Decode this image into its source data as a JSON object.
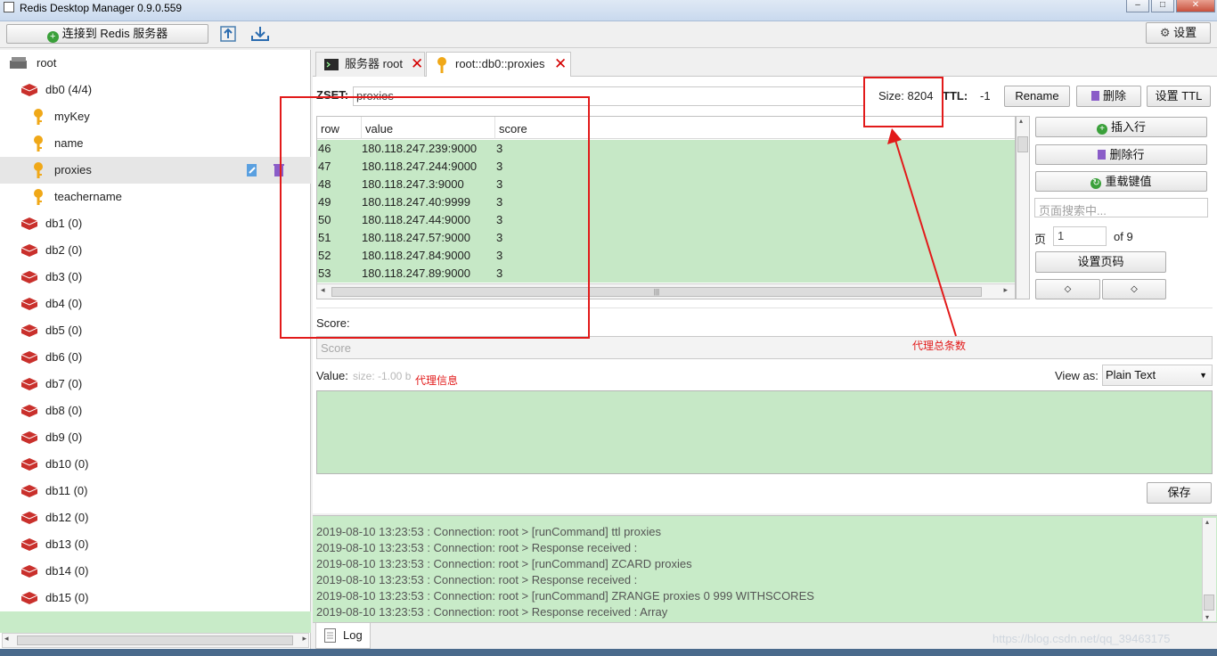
{
  "window": {
    "title": "Redis Desktop Manager 0.9.0.559"
  },
  "toolbar": {
    "connect_label": "连接到 Redis 服务器",
    "settings_label": "设置"
  },
  "sidebar": {
    "root_label": "root",
    "db0_label": "db0  (4/4)",
    "keys": [
      "myKey",
      "name",
      "proxies",
      "teachername"
    ],
    "dbs": [
      "db1 (0)",
      "db2 (0)",
      "db3 (0)",
      "db4 (0)",
      "db5 (0)",
      "db6 (0)",
      "db7 (0)",
      "db8 (0)",
      "db9 (0)",
      "db10 (0)",
      "db11 (0)",
      "db12 (0)",
      "db13 (0)",
      "db14 (0)",
      "db15 (0)"
    ]
  },
  "tabs": [
    {
      "label": "服务器 root"
    },
    {
      "label": "root::db0::proxies"
    }
  ],
  "key_header": {
    "type_label": "ZSET:",
    "key_name": "proxies",
    "size_text": "Size: 8204",
    "ttl_label": "TTL:",
    "ttl_value": "-1",
    "rename_label": "Rename",
    "delete_label": "删除",
    "set_ttl_label": "设置 TTL"
  },
  "grid": {
    "columns": [
      "row",
      "value",
      "score"
    ],
    "rows": [
      [
        "46",
        "180.118.247.239:9000",
        "3"
      ],
      [
        "47",
        "180.118.247.244:9000",
        "3"
      ],
      [
        "48",
        "180.118.247.3:9000",
        "3"
      ],
      [
        "49",
        "180.118.247.40:9999",
        "3"
      ],
      [
        "50",
        "180.118.247.44:9000",
        "3"
      ],
      [
        "51",
        "180.118.247.57:9000",
        "3"
      ],
      [
        "52",
        "180.118.247.84:9000",
        "3"
      ],
      [
        "53",
        "180.118.247.89:9000",
        "3"
      ]
    ]
  },
  "side_actions": {
    "insert_row": "插入行",
    "delete_row": "删除行",
    "reload": "重载键值",
    "search_placeholder": "页面搜索中...",
    "page_label": "页",
    "page_value": "1",
    "of_pages": "of 9",
    "set_page": "设置页码",
    "prev": "◇",
    "next": "◇"
  },
  "editor": {
    "score_label": "Score:",
    "score_placeholder": "Score",
    "value_label": "Value:",
    "value_size": "size: -1.00 b",
    "view_as_label": "View as:",
    "view_as_value": "Plain Text",
    "save_label": "保存"
  },
  "annotations": {
    "size_note": "代理总条数",
    "info_note": "代理信息"
  },
  "log": {
    "lines": [
      "2019-08-10 13:23:53 : Connection: root > [runCommand] ttl proxies",
      "2019-08-10 13:23:53 : Connection: root > Response received :",
      "2019-08-10 13:23:53 : Connection: root > [runCommand] ZCARD proxies",
      "2019-08-10 13:23:53 : Connection: root > Response received :",
      "2019-08-10 13:23:53 : Connection: root > [runCommand] ZRANGE proxies 0 999 WITHSCORES",
      "2019-08-10 13:23:53 : Connection: root > Response received : Array"
    ],
    "tab_label": "Log"
  },
  "watermark": "https://blog.csdn.net/qq_39463175",
  "colors": {
    "accent_red": "#e21a1a",
    "row_green": "#c6e8c6"
  }
}
